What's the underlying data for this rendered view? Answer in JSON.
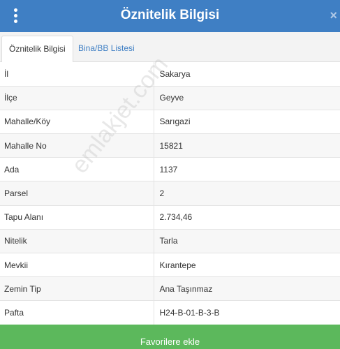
{
  "header": {
    "title": "Öznitelik Bilgisi",
    "menu_icon": "more-vertical-icon",
    "close_icon": "close-icon",
    "close_glyph": "×",
    "color": "#3f7fc4"
  },
  "tabs": [
    {
      "label": "Öznitelik Bilgisi",
      "active": true
    },
    {
      "label": "Bina/BB Listesi",
      "active": false
    }
  ],
  "attributes": [
    {
      "key": "İl",
      "value": "Sakarya"
    },
    {
      "key": "İlçe",
      "value": "Geyve"
    },
    {
      "key": "Mahalle/Köy",
      "value": "Sarıgazi"
    },
    {
      "key": "Mahalle No",
      "value": "15821"
    },
    {
      "key": "Ada",
      "value": "1137"
    },
    {
      "key": "Parsel",
      "value": "2"
    },
    {
      "key": "Tapu Alanı",
      "value": "2.734,46"
    },
    {
      "key": "Nitelik",
      "value": "Tarla"
    },
    {
      "key": "Mevkii",
      "value": "Kırantepe"
    },
    {
      "key": "Zemin Tip",
      "value": "Ana Taşınmaz"
    },
    {
      "key": "Pafta",
      "value": "H24-B-01-B-3-B"
    }
  ],
  "watermark": "emlakjet.com",
  "footer": {
    "favorite_label": "Favorilere ekle",
    "color": "#5cb85c"
  }
}
